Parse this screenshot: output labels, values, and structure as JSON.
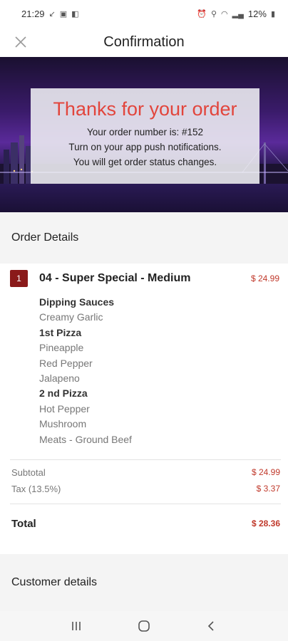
{
  "status_bar": {
    "time": "21:29",
    "battery": "12%"
  },
  "header": {
    "title": "Confirmation"
  },
  "banner": {
    "title": "Thanks for your order",
    "lines": [
      "Your order number is: #152",
      "Turn on your app push notifications.",
      "You will get order status changes."
    ]
  },
  "order_details": {
    "heading": "Order Details",
    "item": {
      "quantity": "1",
      "name": "04 - Super Special - Medium",
      "price": "$ 24.99",
      "modifiers": [
        {
          "text": "Dipping Sauces",
          "group": true
        },
        {
          "text": "Creamy Garlic",
          "group": false
        },
        {
          "text": "1st Pizza",
          "group": true
        },
        {
          "text": "Pineapple",
          "group": false
        },
        {
          "text": "Red Pepper",
          "group": false
        },
        {
          "text": "Jalapeno",
          "group": false
        },
        {
          "text": "2 nd Pizza",
          "group": true
        },
        {
          "text": "Hot Pepper",
          "group": false
        },
        {
          "text": "Mushroom",
          "group": false
        },
        {
          "text": "Meats - Ground Beef",
          "group": false
        }
      ]
    },
    "subtotal_label": "Subtotal",
    "subtotal_value": "$ 24.99",
    "tax_label": "Tax (13.5%)",
    "tax_value": "$ 3.37",
    "total_label": "Total",
    "total_value": "$ 28.36"
  },
  "customer_details": {
    "heading": "Customer details"
  },
  "colors": {
    "accent_red": "#e2453c",
    "price_red": "#c0392b",
    "badge": "#8a1a1a"
  }
}
